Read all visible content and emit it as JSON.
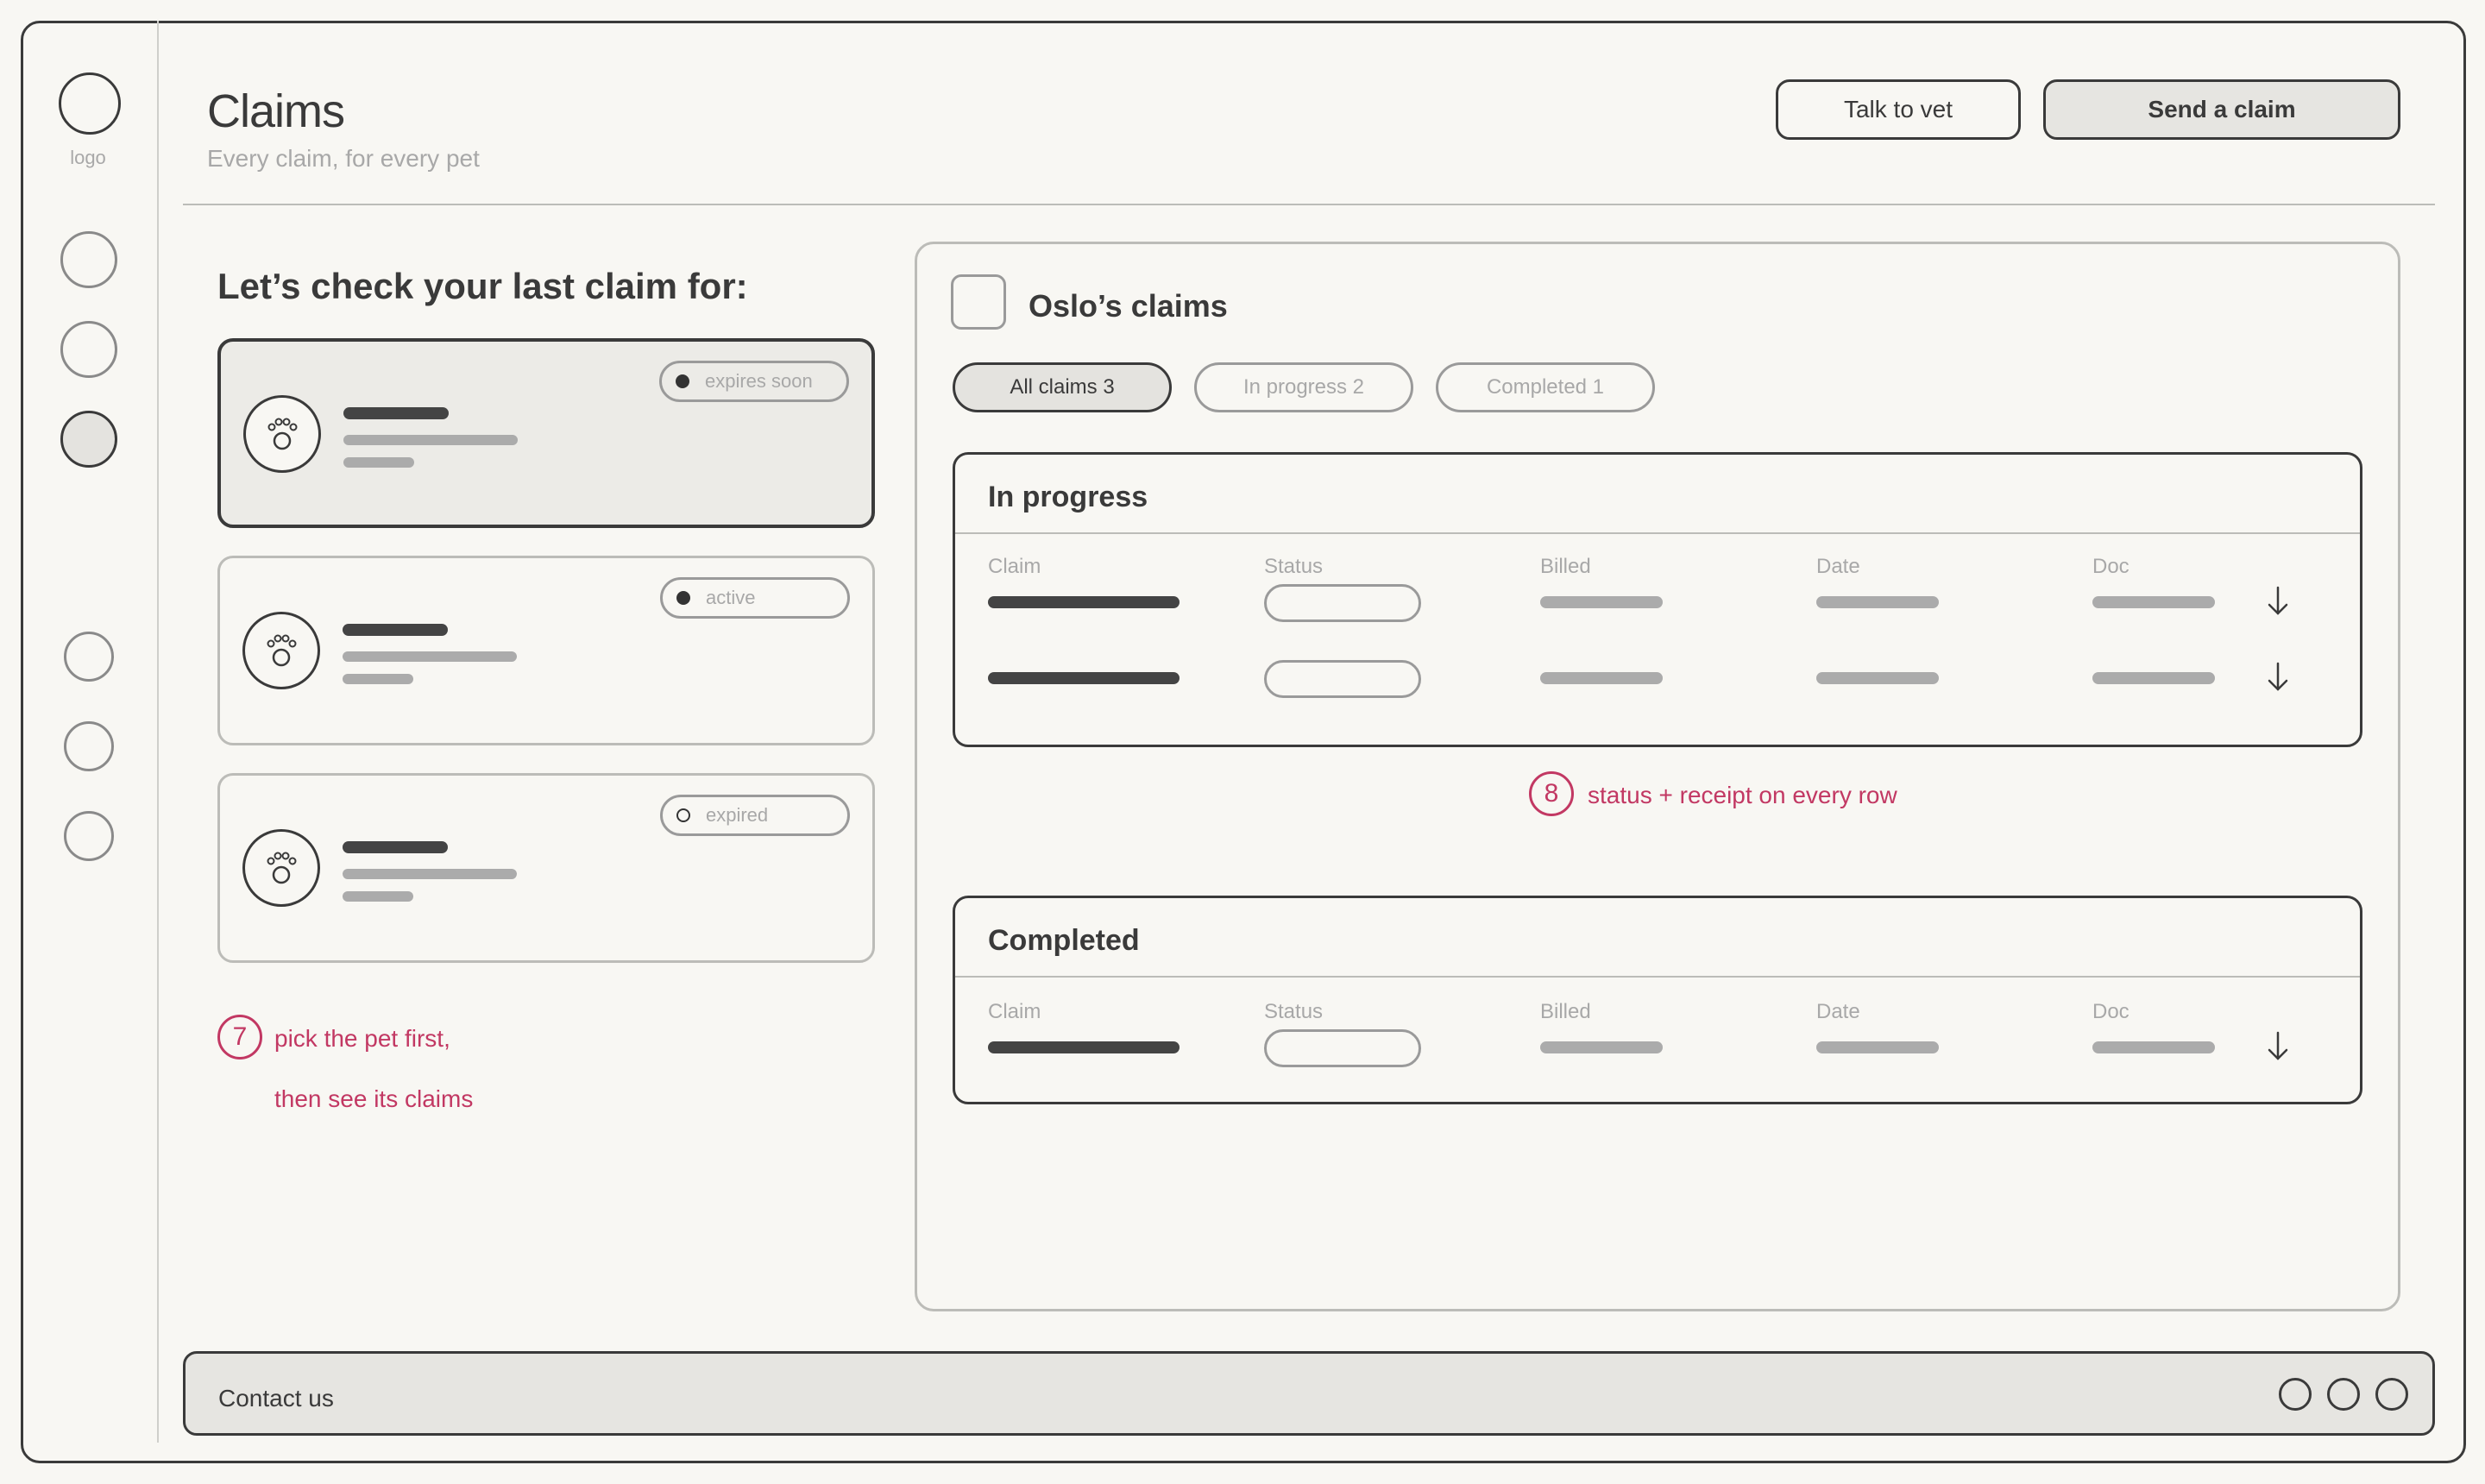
{
  "sidebar": {
    "logo_label": "logo"
  },
  "header": {
    "title": "Claims",
    "subtitle": "Every claim, for every pet",
    "talk_button": "Talk to vet",
    "send_button": "Send a claim"
  },
  "pets": {
    "heading": "Let’s check your last claim for:",
    "cards": [
      {
        "status": "expires soon"
      },
      {
        "status": "active"
      },
      {
        "status": "expired"
      }
    ]
  },
  "notes": {
    "pick": {
      "number": "7",
      "line1": "pick the pet first,",
      "line2": "then see its claims"
    },
    "status": {
      "number": "8",
      "text": "status + receipt on every row"
    }
  },
  "claims_panel": {
    "title": "Oslo’s claims",
    "tabs": [
      {
        "label": "All claims 3"
      },
      {
        "label": "In progress 2"
      },
      {
        "label": "Completed 1"
      }
    ],
    "in_progress": {
      "title": "In progress",
      "columns": [
        "Claim",
        "Status",
        "Billed",
        "Date",
        "Doc"
      ]
    },
    "completed": {
      "title": "Completed",
      "columns": [
        "Claim",
        "Status",
        "Billed",
        "Date",
        "Doc"
      ]
    }
  },
  "footer": {
    "contact": "Contact us"
  }
}
